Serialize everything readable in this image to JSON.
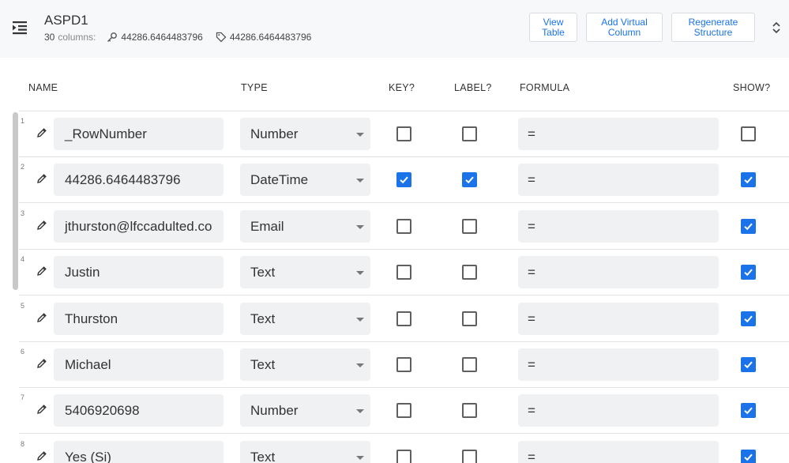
{
  "header": {
    "title": "ASPD1",
    "columns_count": "30",
    "columns_word": "columns:",
    "key_value": "44286.6464483796",
    "label_value": "44286.6464483796",
    "buttons": {
      "view_table": "View\nTable",
      "add_virtual": "Add Virtual\nColumn",
      "regenerate": "Regenerate\nStructure"
    }
  },
  "columns": {
    "name": "NAME",
    "type": "TYPE",
    "key": "KEY?",
    "label": "LABEL?",
    "formula": "FORMULA",
    "show": "SHOW?"
  },
  "colors": {
    "accent": "#1a73e8",
    "field_bg": "#f0f1f3",
    "header_bg": "#f7f8fa"
  },
  "rows": [
    {
      "num": "1",
      "name": "_RowNumber",
      "type": "Number",
      "formula": "=",
      "key": false,
      "label": false,
      "show": false
    },
    {
      "num": "2",
      "name": "44286.6464483796",
      "type": "DateTime",
      "formula": "=",
      "key": true,
      "label": true,
      "show": true
    },
    {
      "num": "3",
      "name": "jthurston@lfccadulted.co",
      "type": "Email",
      "formula": "=",
      "key": false,
      "label": false,
      "show": true
    },
    {
      "num": "4",
      "name": "Justin",
      "type": "Text",
      "formula": "=",
      "key": false,
      "label": false,
      "show": true
    },
    {
      "num": "5",
      "name": "Thurston",
      "type": "Text",
      "formula": "=",
      "key": false,
      "label": false,
      "show": true
    },
    {
      "num": "6",
      "name": "Michael",
      "type": "Text",
      "formula": "=",
      "key": false,
      "label": false,
      "show": true
    },
    {
      "num": "7",
      "name": "5406920698",
      "type": "Number",
      "formula": "=",
      "key": false,
      "label": false,
      "show": true
    },
    {
      "num": "8",
      "name": "Yes (Si)",
      "type": "Text",
      "formula": "=",
      "key": false,
      "label": false,
      "show": true
    }
  ]
}
